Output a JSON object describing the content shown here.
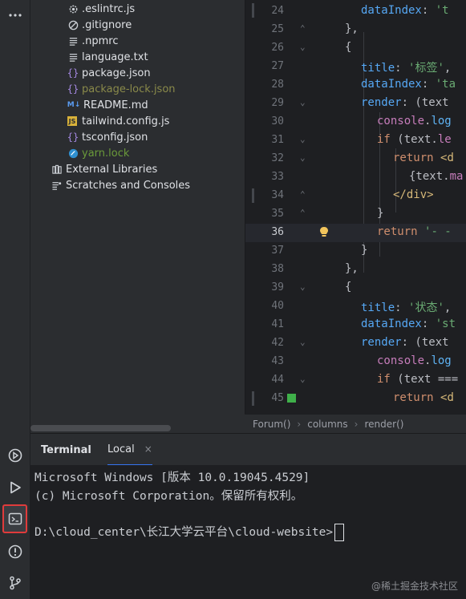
{
  "project_tree": {
    "items": [
      {
        "label": ".eslintrc.js",
        "icon": "eslint-config-icon",
        "status": "normal"
      },
      {
        "label": ".gitignore",
        "icon": "ignore-icon",
        "status": "normal"
      },
      {
        "label": ".npmrc",
        "icon": "text-file-icon",
        "status": "normal"
      },
      {
        "label": "language.txt",
        "icon": "text-file-icon",
        "status": "normal"
      },
      {
        "label": "package.json",
        "icon": "json-icon",
        "status": "normal"
      },
      {
        "label": "package-lock.json",
        "icon": "json-icon",
        "status": "ignored"
      },
      {
        "label": "README.md",
        "icon": "markdown-icon",
        "status": "normal"
      },
      {
        "label": "tailwind.config.js",
        "icon": "js-icon",
        "status": "normal"
      },
      {
        "label": "tsconfig.json",
        "icon": "json-icon",
        "status": "normal"
      },
      {
        "label": "yarn.lock",
        "icon": "yarn-icon",
        "status": "added"
      }
    ],
    "external_libraries": "External Libraries",
    "scratches": "Scratches and Consoles"
  },
  "editor": {
    "current_line": 36,
    "lines": [
      {
        "n": "24",
        "code": "dataIndex: 't"
      },
      {
        "n": "25",
        "code": "},"
      },
      {
        "n": "26",
        "code": "{"
      },
      {
        "n": "27",
        "code": "title: '标签',"
      },
      {
        "n": "28",
        "code": "dataIndex: 'ta"
      },
      {
        "n": "29",
        "code": "render: (text"
      },
      {
        "n": "30",
        "code": "console.log"
      },
      {
        "n": "31",
        "code": "if (text.le"
      },
      {
        "n": "32",
        "code": "return <d"
      },
      {
        "n": "33",
        "code": "{text.ma"
      },
      {
        "n": "34",
        "code": "</div>"
      },
      {
        "n": "35",
        "code": "}"
      },
      {
        "n": "36",
        "code": "return '- -"
      },
      {
        "n": "37",
        "code": "}"
      },
      {
        "n": "38",
        "code": "},"
      },
      {
        "n": "39",
        "code": "{"
      },
      {
        "n": "40",
        "code": "title: '状态',"
      },
      {
        "n": "41",
        "code": "dataIndex: 'st"
      },
      {
        "n": "42",
        "code": "render: (text"
      },
      {
        "n": "43",
        "code": "console.log"
      },
      {
        "n": "44",
        "code": "if (text ==="
      },
      {
        "n": "45",
        "code": "return <d"
      }
    ]
  },
  "breadcrumb": {
    "items": [
      "Forum()",
      "columns",
      "render()"
    ]
  },
  "terminal": {
    "title": "Terminal",
    "tab_label": "Local",
    "close_glyph": "×",
    "lines": [
      "Microsoft Windows [版本 10.0.19045.4529]",
      "(c) Microsoft Corporation。保留所有权利。",
      "",
      "D:\\cloud_center\\长江大学云平台\\cloud-website>"
    ]
  },
  "watermark": "@稀土掘金技术社区",
  "colors": {
    "accent": "#3574f0",
    "highlight_box": "#e03b3b",
    "added": "#6a9a3a",
    "ignored": "#8a8a4a"
  }
}
